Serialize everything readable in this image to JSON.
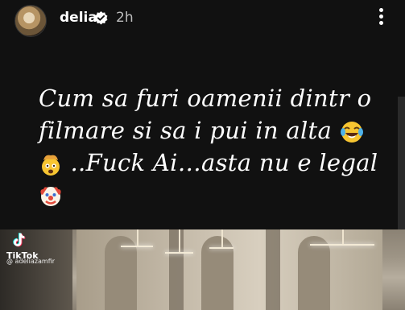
{
  "header": {
    "username": "delia",
    "verified_icon": "verified-badge-icon",
    "timestamp": "2h",
    "more_icon": "more-vertical-icon"
  },
  "caption": {
    "line1": "Cum sa furi oamenii dintr o",
    "line2": "filmare si sa i pui in alta",
    "line2_emoji": "face-with-tears-of-joy-icon",
    "line3_emoji": "exploding-head-icon",
    "line3": "..Fuck Ai…asta nu e legal",
    "line4_emoji": "clown-face-icon"
  },
  "video": {
    "watermark_brand": "TikTok",
    "watermark_handle": "@ adeliazamfir"
  },
  "colors": {
    "background": "#111111",
    "text": "#ffffff",
    "timestamp": "#bdbdbd"
  }
}
